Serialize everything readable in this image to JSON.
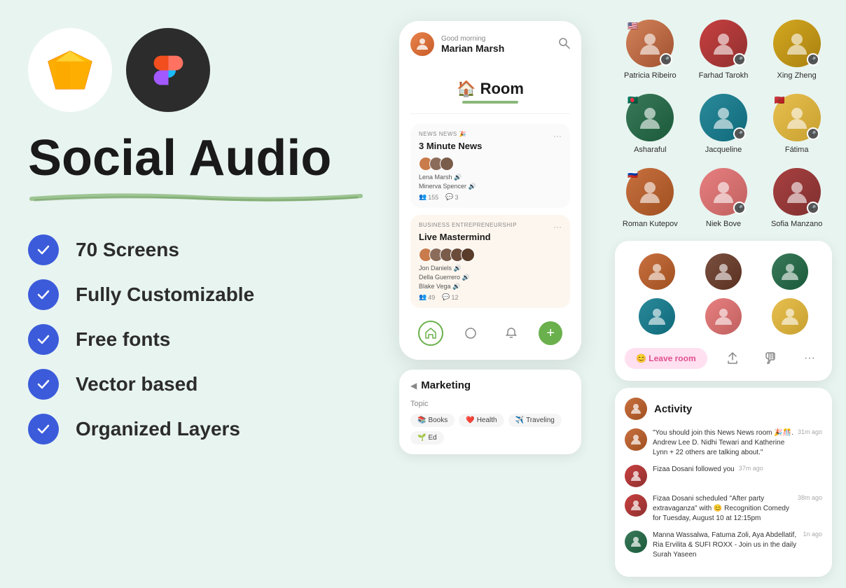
{
  "left": {
    "title": "Social Audio",
    "features": [
      "70 Screens",
      "Fully Customizable",
      "Free fonts",
      "Vector based",
      "Organized Layers"
    ]
  },
  "phone": {
    "greeting": "Good morning",
    "userName": "Marian Marsh",
    "roomTitle": "🏠 Room",
    "newsCard": {
      "tag": "NEWS NEWS 🎉",
      "title": "3 Minute News",
      "persons": [
        "Lena Marsh 🔊",
        "Minerva Spencer 🔊"
      ],
      "stats": {
        "members": "155",
        "messages": "3"
      }
    },
    "businessCard": {
      "tag": "BUSINESS ENTREPRENEURSHIP",
      "title": "Live Mastermind",
      "persons": [
        "Jon Daniels 🔊",
        "Della Guerrero 🔊",
        "Blake Vega 🔊"
      ],
      "stats": {
        "members": "49",
        "messages": "12"
      }
    },
    "nav": {
      "icons": [
        "🏠",
        "⬡",
        "🔔",
        "+"
      ]
    }
  },
  "marketing": {
    "title": "Marketing",
    "topicLabel": "Topic",
    "tags": [
      {
        "emoji": "📚",
        "label": "Books"
      },
      {
        "emoji": "❤️",
        "label": "Health"
      },
      {
        "emoji": "✈️",
        "label": "Traveling"
      },
      {
        "emoji": "🌱",
        "label": "Ed"
      }
    ]
  },
  "usersGrid": {
    "rows": [
      [
        {
          "name": "Patricia Ribeiro",
          "hasFlag": true,
          "hasMic": true,
          "color": "av-orange"
        },
        {
          "name": "Farhad Tarokh",
          "hasFlag": false,
          "hasMic": true,
          "color": "av-red"
        },
        {
          "name": "Xing Zheng",
          "hasFlag": false,
          "hasMic": true,
          "color": "av-yellow"
        }
      ],
      [
        {
          "name": "Asharaful",
          "hasFlag": true,
          "hasMic": false,
          "color": "av-green"
        },
        {
          "name": "Jacqueline",
          "hasFlag": false,
          "hasMic": true,
          "color": "av-teal"
        },
        {
          "name": "Fátima",
          "hasFlag": true,
          "hasMic": true,
          "color": "av-yellow"
        }
      ],
      [
        {
          "name": "Roman Kutepov",
          "hasFlag": true,
          "hasMic": false,
          "color": "av-orange"
        },
        {
          "name": "Niek Bove",
          "hasFlag": false,
          "hasMic": true,
          "color": "av-pink"
        },
        {
          "name": "Sofia Manzano",
          "hasFlag": false,
          "hasMic": true,
          "color": "av-red"
        }
      ]
    ]
  },
  "roomCard": {
    "leaveButton": "😊 Leave room",
    "participants": [
      {
        "color": "av-orange"
      },
      {
        "color": "av-brown"
      },
      {
        "color": "av-green"
      },
      {
        "color": "av-teal"
      },
      {
        "color": "av-pink"
      },
      {
        "color": "av-yellow"
      }
    ]
  },
  "activity": {
    "title": "Activity",
    "items": [
      {
        "text": "\"You should join this News News room 🎉🎊. Andrew Lee D. Nidhi Tewari and Katherine Lynn + 22 others are talking about.\"",
        "time": "31m ago",
        "color": "av-orange"
      },
      {
        "text": "Fizaa Dosani followed you",
        "time": "37m ago",
        "color": "av-red"
      },
      {
        "text": "Fizaa Dosani scheduled \"After party extravaganza\" with 😊 Recognition Comedy for Tuesday, August 10 at 12:15pm",
        "time": "38m ago",
        "color": "av-red"
      },
      {
        "text": "Manna Wassalwa, Fatuma Zoli, Aya Abdellatif, Ria Ervilita & SUFI ROXX - Join us in the daily Surah Yaseen",
        "time": "1n ago",
        "color": "av-green"
      }
    ]
  }
}
